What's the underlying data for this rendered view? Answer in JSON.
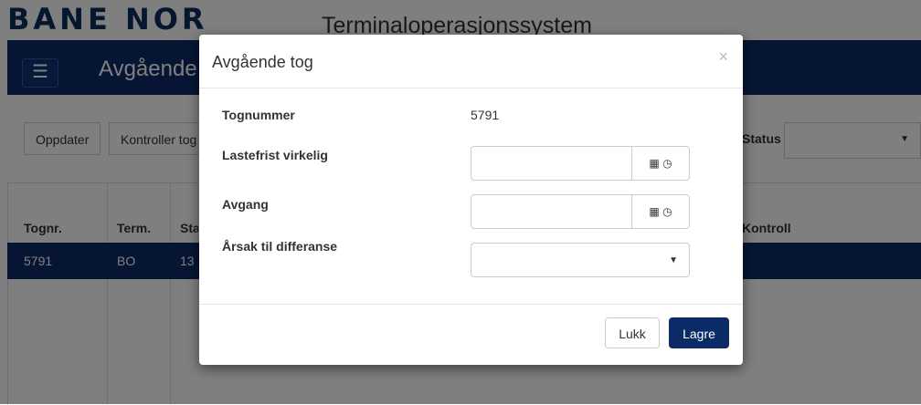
{
  "header": {
    "logo_text": "BANE NOR",
    "app_title": "Terminaloperasjonssystem"
  },
  "nav": {
    "menu_icon": "hamburger-icon",
    "page_heading": "Avgående tog"
  },
  "toolbar": {
    "refresh_label": "Oppdater",
    "check_label": "Kontroller tog",
    "status_label": "Status",
    "status_value": ""
  },
  "grid": {
    "columns": [
      "Tognr.",
      "Term.",
      "Status",
      "Kontroll"
    ],
    "rows": [
      {
        "tognr": "5791",
        "term": "BO",
        "status": "13"
      }
    ]
  },
  "modal": {
    "title": "Avgående tog",
    "close_icon": "close-icon",
    "fields": {
      "tognummer_label": "Tognummer",
      "tognummer_value": "5791",
      "lastefrist_label": "Lastefrist virkelig",
      "lastefrist_value": "",
      "avgang_label": "Avgang",
      "avgang_value": "",
      "arsak_label": "Årsak til differanse",
      "arsak_value": ""
    },
    "icons": {
      "calendar": "calendar-icon",
      "clock": "clock-icon"
    },
    "footer": {
      "close_label": "Lukk",
      "save_label": "Lagre"
    }
  },
  "colors": {
    "brand_navy": "#0b2b66",
    "overlay": "rgba(0,0,0,0.5)"
  }
}
